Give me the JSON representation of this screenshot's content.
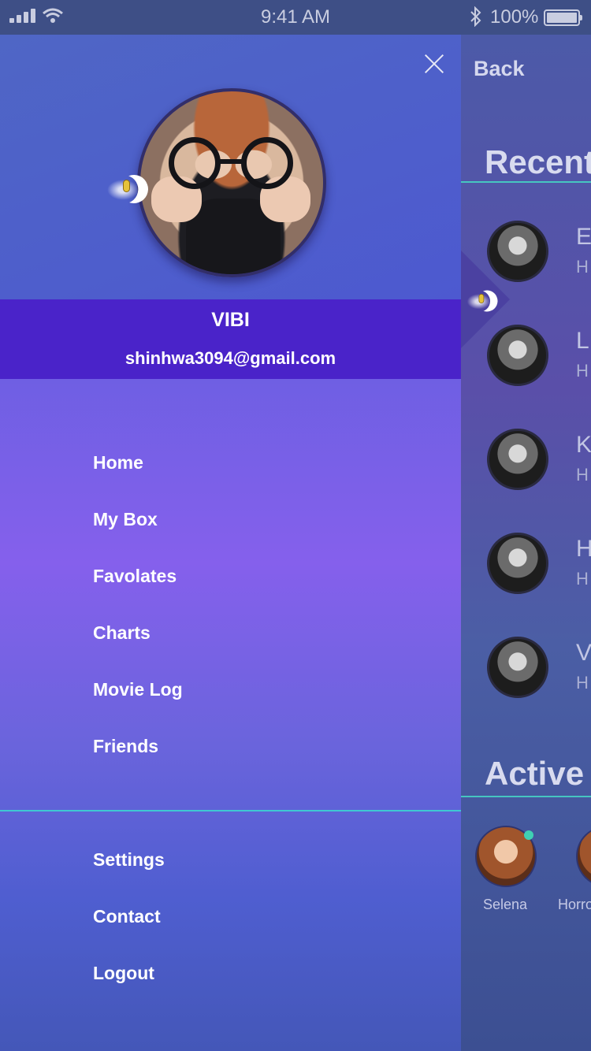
{
  "status_bar": {
    "time": "9:41 AM",
    "battery": "100%"
  },
  "drawer": {
    "close_icon": "close-icon",
    "user": {
      "name": "VIBI",
      "email": "shinhwa3094@gmail.com"
    },
    "menu": [
      {
        "label": "Home"
      },
      {
        "label": "My Box"
      },
      {
        "label": "Favolates"
      },
      {
        "label": "Charts"
      },
      {
        "label": "Movie Log"
      },
      {
        "label": "Friends"
      }
    ],
    "secondary_menu": [
      {
        "label": "Settings"
      },
      {
        "label": "Contact"
      },
      {
        "label": "Logout"
      }
    ]
  },
  "background_screen": {
    "back_label": "Back",
    "recent_title": "Recent",
    "recent_items": [
      {
        "initial": "E",
        "sub": "H"
      },
      {
        "initial": "L",
        "sub": "H"
      },
      {
        "initial": "K",
        "sub": "H"
      },
      {
        "initial": "H",
        "sub": "H"
      },
      {
        "initial": "V",
        "sub": "H"
      }
    ],
    "active_title": "Active",
    "active_items": [
      {
        "name": "Selena"
      },
      {
        "name": "Horro"
      }
    ]
  },
  "colors": {
    "accent_line": "#3fc7d2",
    "user_band": "#4a23c9",
    "online_dot": "#3fd0b3"
  }
}
